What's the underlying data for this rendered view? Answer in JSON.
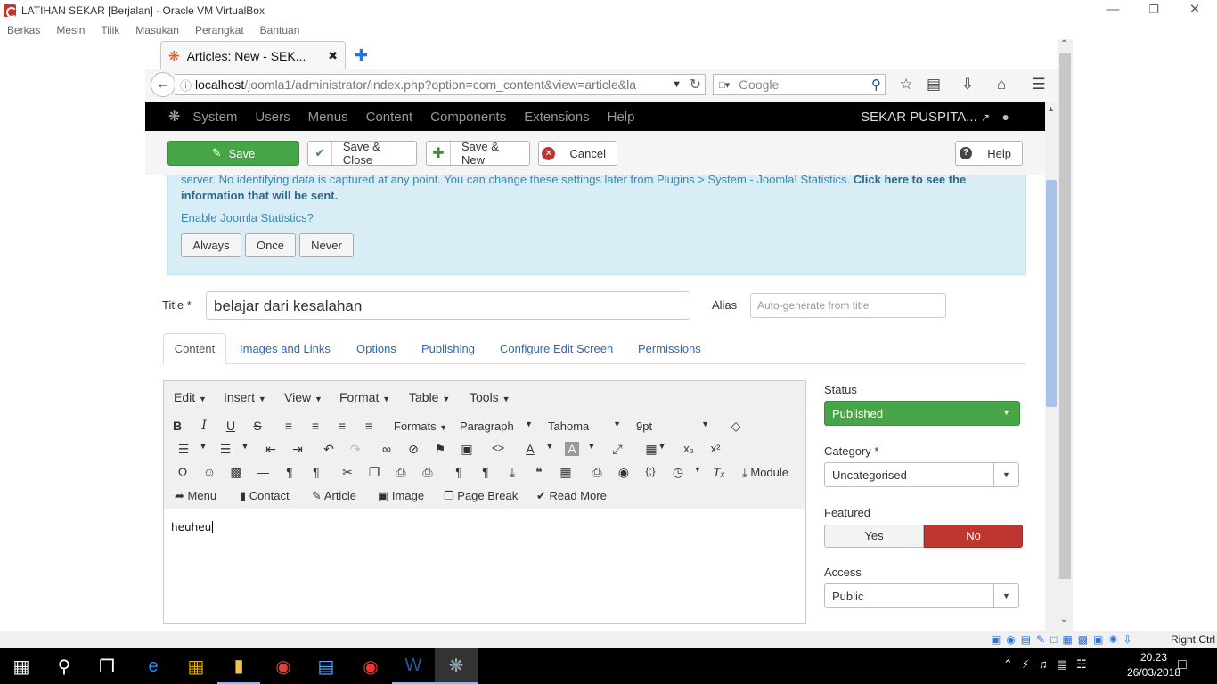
{
  "vbox": {
    "title": "LATIHAN SEKAR [Berjalan] - Oracle VM VirtualBox",
    "menu": [
      "Berkas",
      "Mesin",
      "Tilik",
      "Masukan",
      "Perangkat",
      "Bantuan"
    ],
    "hostkey": "Right Ctrl"
  },
  "browser": {
    "tab_title": "Articles: New - SEK...",
    "url_host": "localhost",
    "url_path": "/joomla1/administrator/index.php?option=com_content&view=article&la",
    "search_placeholder": "Google"
  },
  "joomla": {
    "nav": [
      "System",
      "Users",
      "Menus",
      "Content",
      "Components",
      "Extensions",
      "Help"
    ],
    "site_name": "SEKAR PUSPITA...",
    "toolbar": {
      "save": "Save",
      "save_close": "Save & Close",
      "save_new": "Save & New",
      "cancel": "Cancel",
      "help": "Help"
    },
    "stats_alert": {
      "text_line1": "server. No identifying data is captured at any point. You can change these settings later from Plugins > System - Joomla! Statistics.",
      "link_text_1": "Click here to see the",
      "link_text_2": "information that will be sent.",
      "question": "Enable Joomla Statistics?",
      "buttons": [
        "Always",
        "Once",
        "Never"
      ]
    },
    "form": {
      "title_label": "Title *",
      "title_value": "belajar dari kesalahan",
      "alias_label": "Alias",
      "alias_placeholder": "Auto-generate from title"
    },
    "tabs": [
      "Content",
      "Images and Links",
      "Options",
      "Publishing",
      "Configure Edit Screen",
      "Permissions"
    ],
    "editor": {
      "menus": [
        "Edit",
        "Insert",
        "View",
        "Format",
        "Table",
        "Tools"
      ],
      "formats": "Formats",
      "block": "Paragraph",
      "font": "Tahoma",
      "size": "9pt",
      "module_btn": "Module",
      "xtd_buttons": [
        "Menu",
        "Contact",
        "Article",
        "Image",
        "Page Break",
        "Read More"
      ],
      "body_text": "heuheu"
    },
    "sidebar": {
      "status_label": "Status",
      "status_value": "Published",
      "category_label": "Category *",
      "category_value": "Uncategorised",
      "featured_label": "Featured",
      "featured_yes": "Yes",
      "featured_no": "No",
      "featured_selected": "No",
      "access_label": "Access",
      "access_value": "Public"
    }
  },
  "taskbar": {
    "time": "20.23",
    "date": "26/03/2018"
  },
  "colors": {
    "save_green": "#46a546",
    "no_red": "#bd362f",
    "alert_bg": "#d9edf7",
    "link_blue": "#2a69b8"
  }
}
